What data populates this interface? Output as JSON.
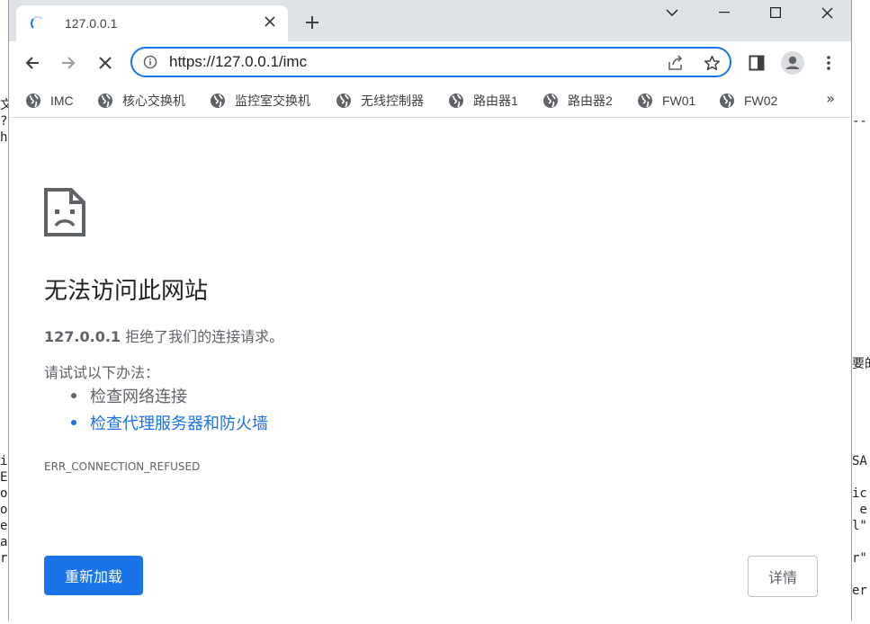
{
  "background_left_lines": [
    "",
    "",
    "",
    "",
    "",
    "",
    "文",
    "?",
    "h",
    "",
    "",
    "",
    "",
    "",
    "",
    "",
    "",
    "",
    "",
    "",
    "",
    "",
    "",
    "",
    "",
    "",
    "",
    "",
    "i",
    "E",
    "o",
    "o",
    "e",
    "a",
    "r"
  ],
  "background_right_lines": [
    "",
    "",
    "",
    "",
    "",
    "",
    "",
    "--",
    "",
    "",
    "",
    "",
    "",
    "",
    "",
    "",
    "",
    "",
    "",
    "",
    "",
    "",
    "要的",
    "",
    "",
    "",
    "",
    "",
    "SA",
    "",
    "ic",
    " e",
    "l\"",
    "",
    "r\"",
    "",
    "er"
  ],
  "tab": {
    "title": "127.0.0.1"
  },
  "toolbar": {
    "url": "https://127.0.0.1/imc"
  },
  "bookmarks": [
    {
      "label": "IMC"
    },
    {
      "label": "核心交换机"
    },
    {
      "label": "监控室交换机"
    },
    {
      "label": "无线控制器"
    },
    {
      "label": "路由器1"
    },
    {
      "label": "路由器2"
    },
    {
      "label": "FW01"
    },
    {
      "label": "FW02"
    }
  ],
  "bookmarks_overflow": "»",
  "error_page": {
    "heading": "无法访问此网站",
    "host": "127.0.0.1",
    "message": " 拒绝了我们的连接请求。",
    "try_label": "请试试以下办法：",
    "suggestions": [
      "检查网络连接",
      "检查代理服务器和防火墙"
    ],
    "error_code": "ERR_CONNECTION_REFUSED",
    "reload_label": "重新加载",
    "details_label": "详情"
  },
  "colors": {
    "accent": "#1a73e8",
    "titlebar": "#dee1e6",
    "text_secondary": "#5f6368"
  }
}
